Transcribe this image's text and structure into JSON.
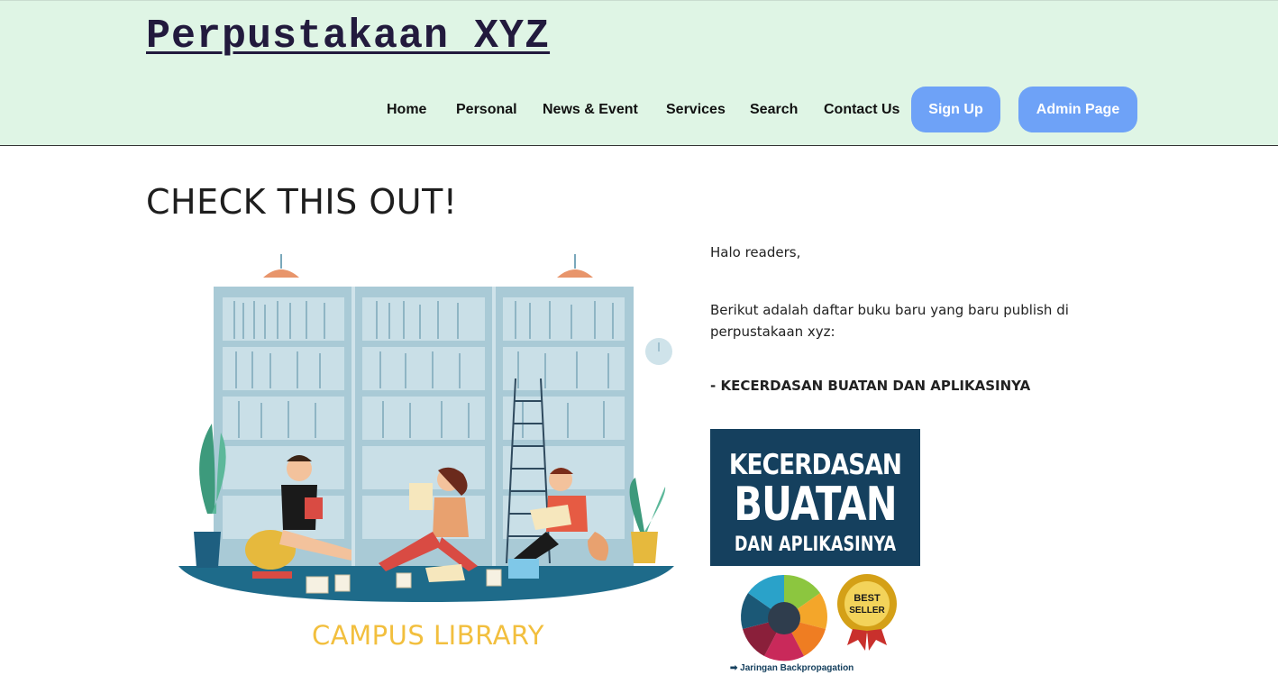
{
  "header": {
    "site_title": "Perpustakaan XYZ",
    "nav": [
      {
        "label": "Home"
      },
      {
        "label": "Personal"
      },
      {
        "label": "News & Event"
      },
      {
        "label": "Services"
      },
      {
        "label": "Search"
      },
      {
        "label": "Contact Us"
      }
    ],
    "signup_label": "Sign Up",
    "admin_label": "Admin Page"
  },
  "main": {
    "section_title": "CHECK THIS OUT!",
    "illustration_caption": "CAMPUS LIBRARY",
    "greeting": "Halo readers,",
    "intro": "Berikut adalah daftar buku baru yang baru publish di perpustakaan xyz:",
    "book_item": "- KECERDASAN BUATAN DAN APLIKASINYA",
    "cover": {
      "line1": "KECERDASAN",
      "line2": "BUATAN",
      "line3": "DAN APLIKASINYA",
      "badge_line1": "BEST",
      "badge_line2": "SELLER",
      "footer": "➡ Jaringan Backpropagation"
    }
  },
  "colors": {
    "header_bg": "#dff5e5",
    "button_bg": "#6ea2f7",
    "caption": "#f2bf3e",
    "cover_bg": "#15405e"
  }
}
